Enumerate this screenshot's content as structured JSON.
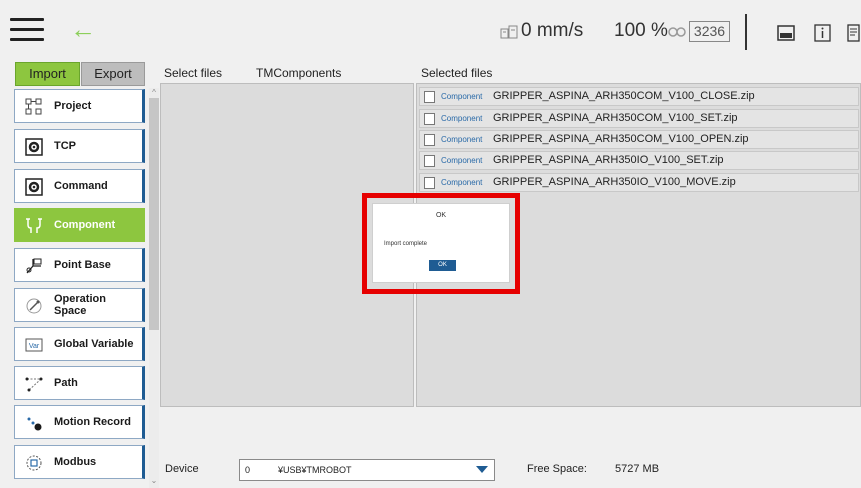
{
  "topbar": {
    "speed": "0 mm/s",
    "speed_percent": "100 %",
    "code": "3236"
  },
  "tabs": {
    "import_label": "Import",
    "export_label": "Export"
  },
  "headers": {
    "select_files": "Select files",
    "folder": "TMComponents",
    "selected_files": "Selected files"
  },
  "sidebar": {
    "items": [
      {
        "label": "Project",
        "icon": "project-icon"
      },
      {
        "label": "TCP",
        "icon": "gear-icon"
      },
      {
        "label": "Command",
        "icon": "gear-icon"
      },
      {
        "label": "Component",
        "icon": "component-icon",
        "active": true
      },
      {
        "label": "Point Base",
        "icon": "point-base-icon"
      },
      {
        "label": "Operation Space",
        "icon": "operation-space-icon"
      },
      {
        "label": "Global Variable",
        "icon": "variable-icon"
      },
      {
        "label": "Path",
        "icon": "path-icon"
      },
      {
        "label": "Motion Record",
        "icon": "motion-record-icon"
      },
      {
        "label": "Modbus",
        "icon": "modbus-icon"
      }
    ],
    "var_icon_text": "Var"
  },
  "files": [
    {
      "tag": "Component",
      "name": "GRIPPER_ASPINA_ARH350COM_V100_CLOSE.zip"
    },
    {
      "tag": "Component",
      "name": "GRIPPER_ASPINA_ARH350COM_V100_SET.zip"
    },
    {
      "tag": "Component",
      "name": "GRIPPER_ASPINA_ARH350COM_V100_OPEN.zip"
    },
    {
      "tag": "Component",
      "name": "GRIPPER_ASPINA_ARH350IO_V100_SET.zip"
    },
    {
      "tag": "Component",
      "name": "GRIPPER_ASPINA_ARH350IO_V100_MOVE.zip"
    }
  ],
  "dialog": {
    "title": "OK",
    "message": "Import complete",
    "ok_label": "OK"
  },
  "bottom": {
    "device_label": "Device",
    "device_index": "0",
    "device_path": "¥USB¥TMROBOT",
    "free_space_label": "Free Space:",
    "free_space_value": "5727 MB"
  },
  "colors": {
    "accent_green": "#8dc63f",
    "brand_blue": "#1f5c93",
    "highlight_red": "#e60000"
  }
}
